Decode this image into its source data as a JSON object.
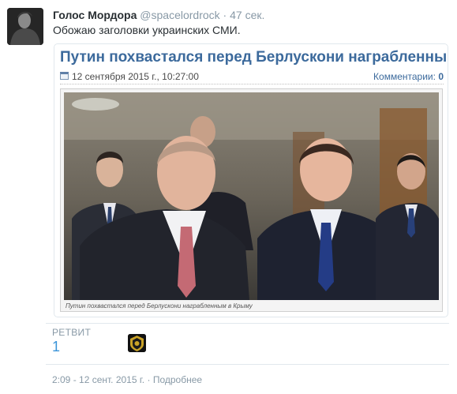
{
  "tweet": {
    "author_name": "Голос Мордора",
    "author_handle": "@spacelordrock",
    "separator": "·",
    "relative_time": "47 сек.",
    "text": "Обожаю заголовки украинских СМИ."
  },
  "card": {
    "headline": "Путин похвастался перед Берлускони награбленным в Крыму",
    "date": "12 сентября 2015 г., 10:27:00",
    "comments_label": "Комментарии:",
    "comments_count": "0",
    "photo_caption": "Путин похвастался перед Берлускони награбленным в Крыму"
  },
  "stats": {
    "retweets_label": "РЕТВИТ",
    "retweets_count": "1"
  },
  "footer": {
    "timestamp": "2:09 - 12 сент. 2015 г.",
    "separator": "·",
    "details_link": "Подробнее"
  },
  "colors": {
    "headline": "#3c6a9c",
    "stat_value": "#3b94d9",
    "muted": "#8899a6"
  }
}
